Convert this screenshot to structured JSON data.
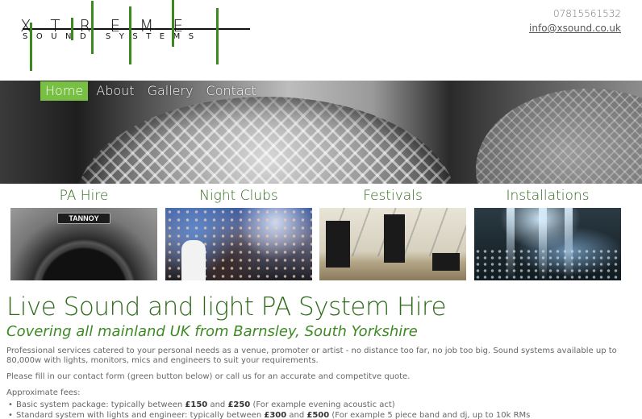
{
  "logo": {
    "wordmark": "XTREME",
    "tagline": "SOUND SYSTEMS",
    "accent_color": "#3a8a1f"
  },
  "contact": {
    "phone": "07815561532",
    "email": "info@xsound.co.uk"
  },
  "nav": {
    "items": [
      "Home",
      "About",
      "Gallery",
      "Contact"
    ],
    "active": "Home",
    "active_color": "#77c043"
  },
  "services": [
    {
      "title": "PA Hire",
      "badge": "TANNOY"
    },
    {
      "title": "Night Clubs"
    },
    {
      "title": "Festivals"
    },
    {
      "title": "Installations"
    }
  ],
  "main": {
    "heading": "Live Sound and light PA System Hire",
    "subheading": "Covering all mainland UK from Barnsley, South Yorkshire",
    "intro": "Professional services catered to your personal needs as a venue, promoter or artist - no distance too far, no job too big. Sound systems available up to 80,000w with lights, monitors, mics and engineers to suit your requirements.",
    "cta": "Please fill in our contact form (green button below) or call us for an accurate and competitve quote.",
    "fees_label": "Approximate fees:",
    "fees": [
      {
        "prefix": "Basic system package: typically between ",
        "low": "£150",
        "mid": " and ",
        "high": "£250",
        "suffix": " (For example evening acoustic act)"
      },
      {
        "prefix": "Standard system with lights and engineer: typically between ",
        "low": "£300",
        "mid": " and ",
        "high": "£500",
        "suffix": " (For example 5 piece band and dj, up to 10k RMs"
      }
    ],
    "heading_color": "#2f6b1a"
  }
}
